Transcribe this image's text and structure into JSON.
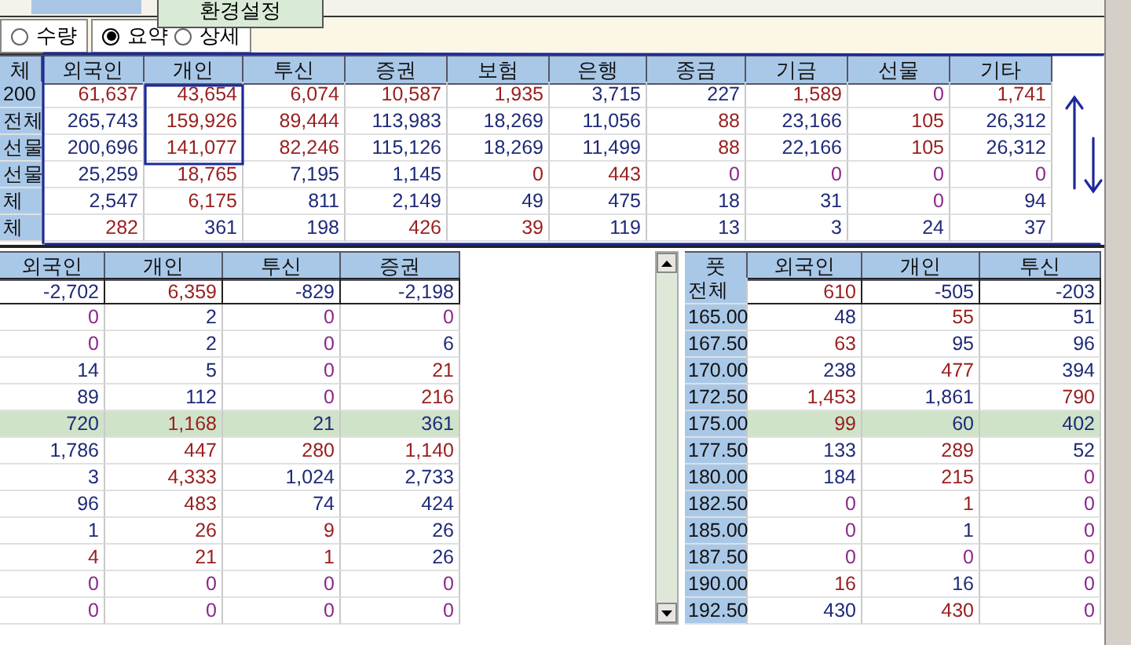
{
  "top_bar": {
    "tooltip": "환경설정"
  },
  "view_options": [
    {
      "label": "수량",
      "selected": false
    },
    {
      "label": "요약",
      "selected": true
    },
    {
      "label": "상세",
      "selected": false
    }
  ],
  "summary_table": {
    "label_header": "체",
    "columns": [
      "외국인",
      "개인",
      "투신",
      "증권",
      "보험",
      "은행",
      "종금",
      "기금",
      "선물",
      "기타"
    ],
    "rows": [
      {
        "label": "200",
        "cells": [
          {
            "text": "61,637",
            "color": "#9a2020"
          },
          {
            "text": "43,654",
            "color": "#9a2020"
          },
          {
            "text": "6,074",
            "color": "#9a2020"
          },
          {
            "text": "10,587",
            "color": "#9a2020"
          },
          {
            "text": "1,935",
            "color": "#9a2020"
          },
          {
            "text": "3,715",
            "color": "#1e2a78"
          },
          {
            "text": "227",
            "color": "#1e2a78"
          },
          {
            "text": "1,589",
            "color": "#9a2020"
          },
          {
            "text": "0",
            "color": "#8a2a8a"
          },
          {
            "text": "1,741",
            "color": "#9a2020"
          }
        ]
      },
      {
        "label": "전체",
        "cells": [
          {
            "text": "265,743",
            "color": "#1e2a78"
          },
          {
            "text": "159,926",
            "color": "#9a2020"
          },
          {
            "text": "89,444",
            "color": "#9a2020"
          },
          {
            "text": "113,983",
            "color": "#1e2a78"
          },
          {
            "text": "18,269",
            "color": "#1e2a78"
          },
          {
            "text": "11,056",
            "color": "#1e2a78"
          },
          {
            "text": "88",
            "color": "#9a2020"
          },
          {
            "text": "23,166",
            "color": "#1e2a78"
          },
          {
            "text": "105",
            "color": "#9a2020"
          },
          {
            "text": "26,312",
            "color": "#1e2a78"
          }
        ]
      },
      {
        "label": "선물",
        "cells": [
          {
            "text": "200,696",
            "color": "#1e2a78"
          },
          {
            "text": "141,077",
            "color": "#9a2020"
          },
          {
            "text": "82,246",
            "color": "#9a2020"
          },
          {
            "text": "115,126",
            "color": "#1e2a78"
          },
          {
            "text": "18,269",
            "color": "#1e2a78"
          },
          {
            "text": "11,499",
            "color": "#1e2a78"
          },
          {
            "text": "88",
            "color": "#9a2020"
          },
          {
            "text": "22,166",
            "color": "#1e2a78"
          },
          {
            "text": "105",
            "color": "#9a2020"
          },
          {
            "text": "26,312",
            "color": "#1e2a78"
          }
        ]
      },
      {
        "label": "선물",
        "cells": [
          {
            "text": "25,259",
            "color": "#1e2a78"
          },
          {
            "text": "18,765",
            "color": "#9a2020"
          },
          {
            "text": "7,195",
            "color": "#1e2a78"
          },
          {
            "text": "1,145",
            "color": "#1e2a78"
          },
          {
            "text": "0",
            "color": "#9a2020"
          },
          {
            "text": "443",
            "color": "#9a2020"
          },
          {
            "text": "0",
            "color": "#8a2a8a"
          },
          {
            "text": "0",
            "color": "#8a2a8a"
          },
          {
            "text": "0",
            "color": "#8a2a8a"
          },
          {
            "text": "0",
            "color": "#8a2a8a"
          }
        ]
      },
      {
        "label": "체",
        "cells": [
          {
            "text": "2,547",
            "color": "#1e2a78"
          },
          {
            "text": "6,175",
            "color": "#9a2020"
          },
          {
            "text": "811",
            "color": "#1e2a78"
          },
          {
            "text": "2,149",
            "color": "#1e2a78"
          },
          {
            "text": "49",
            "color": "#1e2a78"
          },
          {
            "text": "475",
            "color": "#1e2a78"
          },
          {
            "text": "18",
            "color": "#1e2a78"
          },
          {
            "text": "31",
            "color": "#1e2a78"
          },
          {
            "text": "0",
            "color": "#8a2a8a"
          },
          {
            "text": "94",
            "color": "#1e2a78"
          }
        ]
      },
      {
        "label": "체",
        "cells": [
          {
            "text": "282",
            "color": "#9a2020"
          },
          {
            "text": "361",
            "color": "#1e2a78"
          },
          {
            "text": "198",
            "color": "#1e2a78"
          },
          {
            "text": "426",
            "color": "#9a2020"
          },
          {
            "text": "39",
            "color": "#9a2020"
          },
          {
            "text": "119",
            "color": "#1e2a78"
          },
          {
            "text": "13",
            "color": "#1e2a78"
          },
          {
            "text": "3",
            "color": "#1e2a78"
          },
          {
            "text": "24",
            "color": "#1e2a78"
          },
          {
            "text": "37",
            "color": "#1e2a78"
          }
        ]
      }
    ]
  },
  "call_table": {
    "columns": [
      "외국인",
      "개인",
      "투신",
      "증권"
    ],
    "rows": [
      {
        "kind": "total",
        "highlighted": false,
        "cells": [
          {
            "text": "-2,702",
            "color": "#1e2a78"
          },
          {
            "text": "6,359",
            "color": "#9a2020"
          },
          {
            "text": "-829",
            "color": "#1e2a78"
          },
          {
            "text": "-2,198",
            "color": "#1e2a78"
          }
        ]
      },
      {
        "kind": "strike",
        "highlighted": false,
        "cells": [
          {
            "text": "0",
            "color": "#8a2a8a"
          },
          {
            "text": "2",
            "color": "#1e2a78"
          },
          {
            "text": "0",
            "color": "#8a2a8a"
          },
          {
            "text": "0",
            "color": "#8a2a8a"
          }
        ]
      },
      {
        "kind": "strike",
        "highlighted": false,
        "cells": [
          {
            "text": "0",
            "color": "#8a2a8a"
          },
          {
            "text": "2",
            "color": "#1e2a78"
          },
          {
            "text": "0",
            "color": "#8a2a8a"
          },
          {
            "text": "6",
            "color": "#1e2a78"
          }
        ]
      },
      {
        "kind": "strike",
        "highlighted": false,
        "cells": [
          {
            "text": "14",
            "color": "#1e2a78"
          },
          {
            "text": "5",
            "color": "#1e2a78"
          },
          {
            "text": "0",
            "color": "#8a2a8a"
          },
          {
            "text": "21",
            "color": "#9a2020"
          }
        ]
      },
      {
        "kind": "strike",
        "highlighted": false,
        "cells": [
          {
            "text": "89",
            "color": "#1e2a78"
          },
          {
            "text": "112",
            "color": "#1e2a78"
          },
          {
            "text": "0",
            "color": "#8a2a8a"
          },
          {
            "text": "216",
            "color": "#9a2020"
          }
        ]
      },
      {
        "kind": "strike",
        "highlighted": true,
        "cells": [
          {
            "text": "720",
            "color": "#1e2a78"
          },
          {
            "text": "1,168",
            "color": "#9a2020"
          },
          {
            "text": "21",
            "color": "#1e2a78"
          },
          {
            "text": "361",
            "color": "#1e2a78"
          }
        ]
      },
      {
        "kind": "strike",
        "highlighted": false,
        "cells": [
          {
            "text": "1,786",
            "color": "#1e2a78"
          },
          {
            "text": "447",
            "color": "#9a2020"
          },
          {
            "text": "280",
            "color": "#9a2020"
          },
          {
            "text": "1,140",
            "color": "#9a2020"
          }
        ]
      },
      {
        "kind": "strike",
        "highlighted": false,
        "cells": [
          {
            "text": "3",
            "color": "#1e2a78"
          },
          {
            "text": "4,333",
            "color": "#9a2020"
          },
          {
            "text": "1,024",
            "color": "#1e2a78"
          },
          {
            "text": "2,733",
            "color": "#1e2a78"
          }
        ]
      },
      {
        "kind": "strike",
        "highlighted": false,
        "cells": [
          {
            "text": "96",
            "color": "#1e2a78"
          },
          {
            "text": "483",
            "color": "#9a2020"
          },
          {
            "text": "74",
            "color": "#1e2a78"
          },
          {
            "text": "424",
            "color": "#1e2a78"
          }
        ]
      },
      {
        "kind": "strike",
        "highlighted": false,
        "cells": [
          {
            "text": "1",
            "color": "#1e2a78"
          },
          {
            "text": "26",
            "color": "#9a2020"
          },
          {
            "text": "9",
            "color": "#9a2020"
          },
          {
            "text": "26",
            "color": "#1e2a78"
          }
        ]
      },
      {
        "kind": "strike",
        "highlighted": false,
        "cells": [
          {
            "text": "4",
            "color": "#9a2020"
          },
          {
            "text": "21",
            "color": "#9a2020"
          },
          {
            "text": "1",
            "color": "#9a2020"
          },
          {
            "text": "26",
            "color": "#1e2a78"
          }
        ]
      },
      {
        "kind": "strike",
        "highlighted": false,
        "cells": [
          {
            "text": "0",
            "color": "#8a2a8a"
          },
          {
            "text": "0",
            "color": "#8a2a8a"
          },
          {
            "text": "0",
            "color": "#8a2a8a"
          },
          {
            "text": "0",
            "color": "#8a2a8a"
          }
        ]
      },
      {
        "kind": "strike",
        "highlighted": false,
        "cells": [
          {
            "text": "0",
            "color": "#8a2a8a"
          },
          {
            "text": "0",
            "color": "#8a2a8a"
          },
          {
            "text": "0",
            "color": "#8a2a8a"
          },
          {
            "text": "0",
            "color": "#8a2a8a"
          }
        ]
      }
    ]
  },
  "put_table": {
    "label_header": "풋",
    "columns": [
      "외국인",
      "개인",
      "투신"
    ],
    "rows": [
      {
        "kind": "total",
        "label": "전체",
        "highlighted": false,
        "cells": [
          {
            "text": "610",
            "color": "#9a2020"
          },
          {
            "text": "-505",
            "color": "#1e2a78"
          },
          {
            "text": "-203",
            "color": "#1e2a78"
          }
        ]
      },
      {
        "kind": "strike",
        "label": "165.00",
        "highlighted": false,
        "cells": [
          {
            "text": "48",
            "color": "#1e2a78"
          },
          {
            "text": "55",
            "color": "#9a2020"
          },
          {
            "text": "51",
            "color": "#1e2a78"
          }
        ]
      },
      {
        "kind": "strike",
        "label": "167.50",
        "highlighted": false,
        "cells": [
          {
            "text": "63",
            "color": "#9a2020"
          },
          {
            "text": "95",
            "color": "#1e2a78"
          },
          {
            "text": "96",
            "color": "#1e2a78"
          }
        ]
      },
      {
        "kind": "strike",
        "label": "170.00",
        "highlighted": false,
        "cells": [
          {
            "text": "238",
            "color": "#1e2a78"
          },
          {
            "text": "477",
            "color": "#9a2020"
          },
          {
            "text": "394",
            "color": "#1e2a78"
          }
        ]
      },
      {
        "kind": "strike",
        "label": "172.50",
        "highlighted": false,
        "cells": [
          {
            "text": "1,453",
            "color": "#9a2020"
          },
          {
            "text": "1,861",
            "color": "#1e2a78"
          },
          {
            "text": "790",
            "color": "#9a2020"
          }
        ]
      },
      {
        "kind": "strike",
        "label": "175.00",
        "highlighted": true,
        "cells": [
          {
            "text": "99",
            "color": "#9a2020"
          },
          {
            "text": "60",
            "color": "#1e2a78"
          },
          {
            "text": "402",
            "color": "#1e2a78"
          }
        ]
      },
      {
        "kind": "strike",
        "label": "177.50",
        "highlighted": false,
        "cells": [
          {
            "text": "133",
            "color": "#1e2a78"
          },
          {
            "text": "289",
            "color": "#9a2020"
          },
          {
            "text": "52",
            "color": "#1e2a78"
          }
        ]
      },
      {
        "kind": "strike",
        "label": "180.00",
        "highlighted": false,
        "cells": [
          {
            "text": "184",
            "color": "#1e2a78"
          },
          {
            "text": "215",
            "color": "#9a2020"
          },
          {
            "text": "0",
            "color": "#8a2a8a"
          }
        ]
      },
      {
        "kind": "strike",
        "label": "182.50",
        "highlighted": false,
        "cells": [
          {
            "text": "0",
            "color": "#8a2a8a"
          },
          {
            "text": "1",
            "color": "#9a2020"
          },
          {
            "text": "0",
            "color": "#8a2a8a"
          }
        ]
      },
      {
        "kind": "strike",
        "label": "185.00",
        "highlighted": false,
        "cells": [
          {
            "text": "0",
            "color": "#8a2a8a"
          },
          {
            "text": "1",
            "color": "#1e2a78"
          },
          {
            "text": "0",
            "color": "#8a2a8a"
          }
        ]
      },
      {
        "kind": "strike",
        "label": "187.50",
        "highlighted": false,
        "cells": [
          {
            "text": "0",
            "color": "#8a2a8a"
          },
          {
            "text": "0",
            "color": "#8a2a8a"
          },
          {
            "text": "0",
            "color": "#8a2a8a"
          }
        ]
      },
      {
        "kind": "strike",
        "label": "190.00",
        "highlighted": false,
        "cells": [
          {
            "text": "16",
            "color": "#9a2020"
          },
          {
            "text": "16",
            "color": "#1e2a78"
          },
          {
            "text": "0",
            "color": "#8a2a8a"
          }
        ]
      },
      {
        "kind": "strike",
        "label": "192.50",
        "highlighted": false,
        "cells": [
          {
            "text": "430",
            "color": "#1e2a78"
          },
          {
            "text": "430",
            "color": "#9a2020"
          },
          {
            "text": "0",
            "color": "#8a2a8a"
          }
        ]
      }
    ]
  }
}
